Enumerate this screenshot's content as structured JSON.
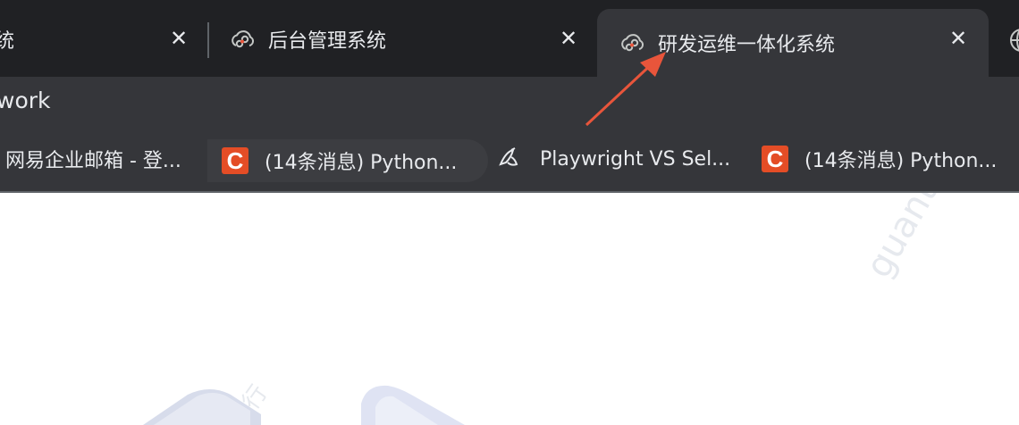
{
  "tabs": [
    {
      "label": "统",
      "close": "✕",
      "icon": "none"
    },
    {
      "label": "后台管理系统",
      "close": "✕",
      "icon": "cloud-link-icon"
    },
    {
      "label": "研发运维一体化系统",
      "close": "✕",
      "icon": "cloud-link-icon",
      "active": true
    }
  ],
  "address": {
    "text": "work"
  },
  "bookmarks": [
    {
      "label": "网易企业邮箱 - 登...",
      "icon": "none"
    },
    {
      "label": "(14条消息) Python...",
      "icon": "csdn-icon"
    },
    {
      "label": "Playwright VS Sel...",
      "icon": "playwright-icon"
    },
    {
      "label": "(14条消息) Python...",
      "icon": "csdn-icon"
    }
  ],
  "watermarks": [
    "guantian",
    "银行"
  ],
  "colors": {
    "chrome_bg": "#202124",
    "toolbar_bg": "#35363a",
    "arrow": "#e8553b",
    "csdn": "#e44d26"
  }
}
